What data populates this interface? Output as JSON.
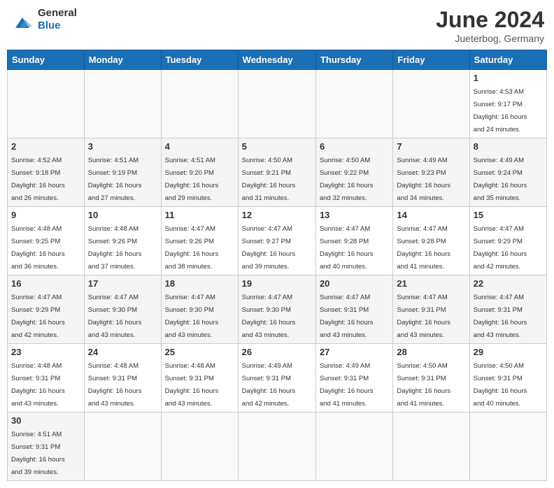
{
  "header": {
    "logo_general": "General",
    "logo_blue": "Blue",
    "month_title": "June 2024",
    "subtitle": "Jueterbog, Germany"
  },
  "weekdays": [
    "Sunday",
    "Monday",
    "Tuesday",
    "Wednesday",
    "Thursday",
    "Friday",
    "Saturday"
  ],
  "days": {
    "1": {
      "sunrise": "4:53 AM",
      "sunset": "9:17 PM",
      "daylight": "16 hours and 24 minutes."
    },
    "2": {
      "sunrise": "4:52 AM",
      "sunset": "9:18 PM",
      "daylight": "16 hours and 26 minutes."
    },
    "3": {
      "sunrise": "4:51 AM",
      "sunset": "9:19 PM",
      "daylight": "16 hours and 27 minutes."
    },
    "4": {
      "sunrise": "4:51 AM",
      "sunset": "9:20 PM",
      "daylight": "16 hours and 29 minutes."
    },
    "5": {
      "sunrise": "4:50 AM",
      "sunset": "9:21 PM",
      "daylight": "16 hours and 31 minutes."
    },
    "6": {
      "sunrise": "4:50 AM",
      "sunset": "9:22 PM",
      "daylight": "16 hours and 32 minutes."
    },
    "7": {
      "sunrise": "4:49 AM",
      "sunset": "9:23 PM",
      "daylight": "16 hours and 34 minutes."
    },
    "8": {
      "sunrise": "4:49 AM",
      "sunset": "9:24 PM",
      "daylight": "16 hours and 35 minutes."
    },
    "9": {
      "sunrise": "4:48 AM",
      "sunset": "9:25 PM",
      "daylight": "16 hours and 36 minutes."
    },
    "10": {
      "sunrise": "4:48 AM",
      "sunset": "9:26 PM",
      "daylight": "16 hours and 37 minutes."
    },
    "11": {
      "sunrise": "4:47 AM",
      "sunset": "9:26 PM",
      "daylight": "16 hours and 38 minutes."
    },
    "12": {
      "sunrise": "4:47 AM",
      "sunset": "9:27 PM",
      "daylight": "16 hours and 39 minutes."
    },
    "13": {
      "sunrise": "4:47 AM",
      "sunset": "9:28 PM",
      "daylight": "16 hours and 40 minutes."
    },
    "14": {
      "sunrise": "4:47 AM",
      "sunset": "9:28 PM",
      "daylight": "16 hours and 41 minutes."
    },
    "15": {
      "sunrise": "4:47 AM",
      "sunset": "9:29 PM",
      "daylight": "16 hours and 42 minutes."
    },
    "16": {
      "sunrise": "4:47 AM",
      "sunset": "9:29 PM",
      "daylight": "16 hours and 42 minutes."
    },
    "17": {
      "sunrise": "4:47 AM",
      "sunset": "9:30 PM",
      "daylight": "16 hours and 43 minutes."
    },
    "18": {
      "sunrise": "4:47 AM",
      "sunset": "9:30 PM",
      "daylight": "16 hours and 43 minutes."
    },
    "19": {
      "sunrise": "4:47 AM",
      "sunset": "9:30 PM",
      "daylight": "16 hours and 43 minutes."
    },
    "20": {
      "sunrise": "4:47 AM",
      "sunset": "9:31 PM",
      "daylight": "16 hours and 43 minutes."
    },
    "21": {
      "sunrise": "4:47 AM",
      "sunset": "9:31 PM",
      "daylight": "16 hours and 43 minutes."
    },
    "22": {
      "sunrise": "4:47 AM",
      "sunset": "9:31 PM",
      "daylight": "16 hours and 43 minutes."
    },
    "23": {
      "sunrise": "4:48 AM",
      "sunset": "9:31 PM",
      "daylight": "16 hours and 43 minutes."
    },
    "24": {
      "sunrise": "4:48 AM",
      "sunset": "9:31 PM",
      "daylight": "16 hours and 43 minutes."
    },
    "25": {
      "sunrise": "4:48 AM",
      "sunset": "9:31 PM",
      "daylight": "16 hours and 43 minutes."
    },
    "26": {
      "sunrise": "4:49 AM",
      "sunset": "9:31 PM",
      "daylight": "16 hours and 42 minutes."
    },
    "27": {
      "sunrise": "4:49 AM",
      "sunset": "9:31 PM",
      "daylight": "16 hours and 41 minutes."
    },
    "28": {
      "sunrise": "4:50 AM",
      "sunset": "9:31 PM",
      "daylight": "16 hours and 41 minutes."
    },
    "29": {
      "sunrise": "4:50 AM",
      "sunset": "9:31 PM",
      "daylight": "16 hours and 40 minutes."
    },
    "30": {
      "sunrise": "4:51 AM",
      "sunset": "9:31 PM",
      "daylight": "16 hours and 39 minutes."
    }
  }
}
